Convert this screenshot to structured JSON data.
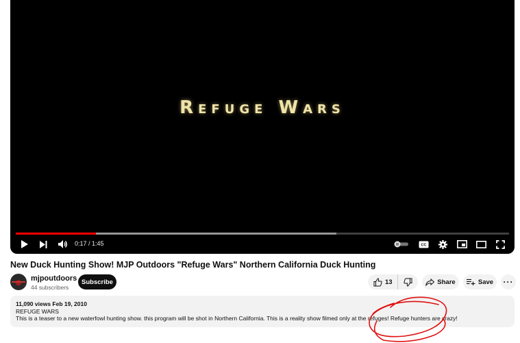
{
  "player": {
    "video_text": "Refuge Wars",
    "current_time": "0:17",
    "separator": " / ",
    "duration": "1:45",
    "played_fraction": 0.162,
    "buffered_fraction": 0.65,
    "icons": [
      "play-icon",
      "next-icon",
      "volume-icon",
      "autoplay-toggle-icon",
      "captions-icon",
      "settings-icon",
      "miniplayer-icon",
      "theater-icon",
      "fullscreen-icon"
    ]
  },
  "video": {
    "title": "New Duck Hunting Show! MJP Outdoors \"Refuge Wars\" Northern California Duck Hunting"
  },
  "channel": {
    "name": "mjpoutdoors",
    "subscribers": "44 subscribers",
    "subscribe_label": "Subscribe"
  },
  "actions": {
    "likes": "13",
    "share_label": "Share",
    "save_label": "Save",
    "more_label": "···"
  },
  "description": {
    "views_date": "11,090 views  Feb 19, 2010",
    "line1": "REFUGE WARS",
    "line2": "This is a teaser to a new waterfowl hunting show. this program will be shot in Northern California. This is a reality show filmed only at the refuges! Refuge hunters are crazy!"
  },
  "colors": {
    "progress": "#ff0000",
    "annotation": "#e01010",
    "title_glow": "#efe3a8"
  }
}
